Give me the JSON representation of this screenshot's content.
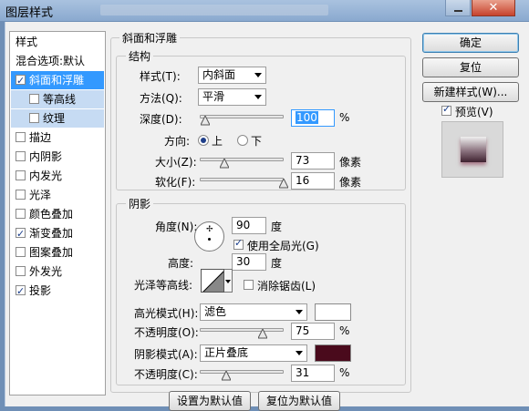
{
  "window": {
    "title": "图层样式",
    "close_glyph": "✕"
  },
  "sidebar": {
    "items": [
      {
        "label": "样式",
        "checkbox": false,
        "checked": false
      },
      {
        "label": "混合选项:默认",
        "checkbox": false,
        "checked": false
      },
      {
        "label": "斜面和浮雕",
        "checkbox": true,
        "checked": true,
        "selected": true
      },
      {
        "label": "等高线",
        "checkbox": true,
        "checked": false,
        "sub": true
      },
      {
        "label": "纹理",
        "checkbox": true,
        "checked": false,
        "sub": true
      },
      {
        "label": "描边",
        "checkbox": true,
        "checked": false
      },
      {
        "label": "内阴影",
        "checkbox": true,
        "checked": false
      },
      {
        "label": "内发光",
        "checkbox": true,
        "checked": false
      },
      {
        "label": "光泽",
        "checkbox": true,
        "checked": false
      },
      {
        "label": "颜色叠加",
        "checkbox": true,
        "checked": false
      },
      {
        "label": "渐变叠加",
        "checkbox": true,
        "checked": true
      },
      {
        "label": "图案叠加",
        "checkbox": true,
        "checked": false
      },
      {
        "label": "外发光",
        "checkbox": true,
        "checked": false
      },
      {
        "label": "投影",
        "checkbox": true,
        "checked": true
      }
    ]
  },
  "bevel": {
    "title": "斜面和浮雕",
    "structure": {
      "title": "结构",
      "style_label": "样式(T):",
      "style_value": "内斜面",
      "technique_label": "方法(Q):",
      "technique_value": "平滑",
      "depth_label": "深度(D):",
      "depth_value": "100",
      "depth_unit": "%",
      "depth_fraction": 0.07,
      "direction_label": "方向:",
      "direction_up": "上",
      "direction_down": "下",
      "size_label": "大小(Z):",
      "size_value": "73",
      "size_unit": "像素",
      "size_fraction": 0.29,
      "soften_label": "软化(F):",
      "soften_value": "16",
      "soften_unit": "像素",
      "soften_fraction": 1.0
    },
    "shading": {
      "title": "阴影",
      "angle_label": "角度(N):",
      "angle_value": "90",
      "angle_unit": "度",
      "global_light_label": "使用全局光(G)",
      "global_light_checked": true,
      "altitude_label": "高度:",
      "altitude_value": "30",
      "altitude_unit": "度",
      "gloss_contour_label": "光泽等高线:",
      "anti_alias_label": "消除锯齿(L)",
      "anti_alias_checked": false,
      "highlight_mode_label": "高光模式(H):",
      "highlight_mode_value": "滤色",
      "highlight_color": "#ffffff",
      "highlight_opacity_label": "不透明度(O):",
      "highlight_opacity_value": "75",
      "highlight_opacity_unit": "%",
      "highlight_opacity_fraction": 0.75,
      "shadow_mode_label": "阴影模式(A):",
      "shadow_mode_value": "正片叠底",
      "shadow_color": "#4a0a1c",
      "shadow_opacity_label": "不透明度(C):",
      "shadow_opacity_value": "31",
      "shadow_opacity_unit": "%",
      "shadow_opacity_fraction": 0.31
    },
    "set_default_label": "设置为默认值",
    "reset_default_label": "复位为默认值"
  },
  "actions": {
    "ok_label": "确定",
    "reset_label": "复位",
    "new_style_label": "新建样式(W)...",
    "preview_label": "预览(V)",
    "preview_checked": true
  }
}
